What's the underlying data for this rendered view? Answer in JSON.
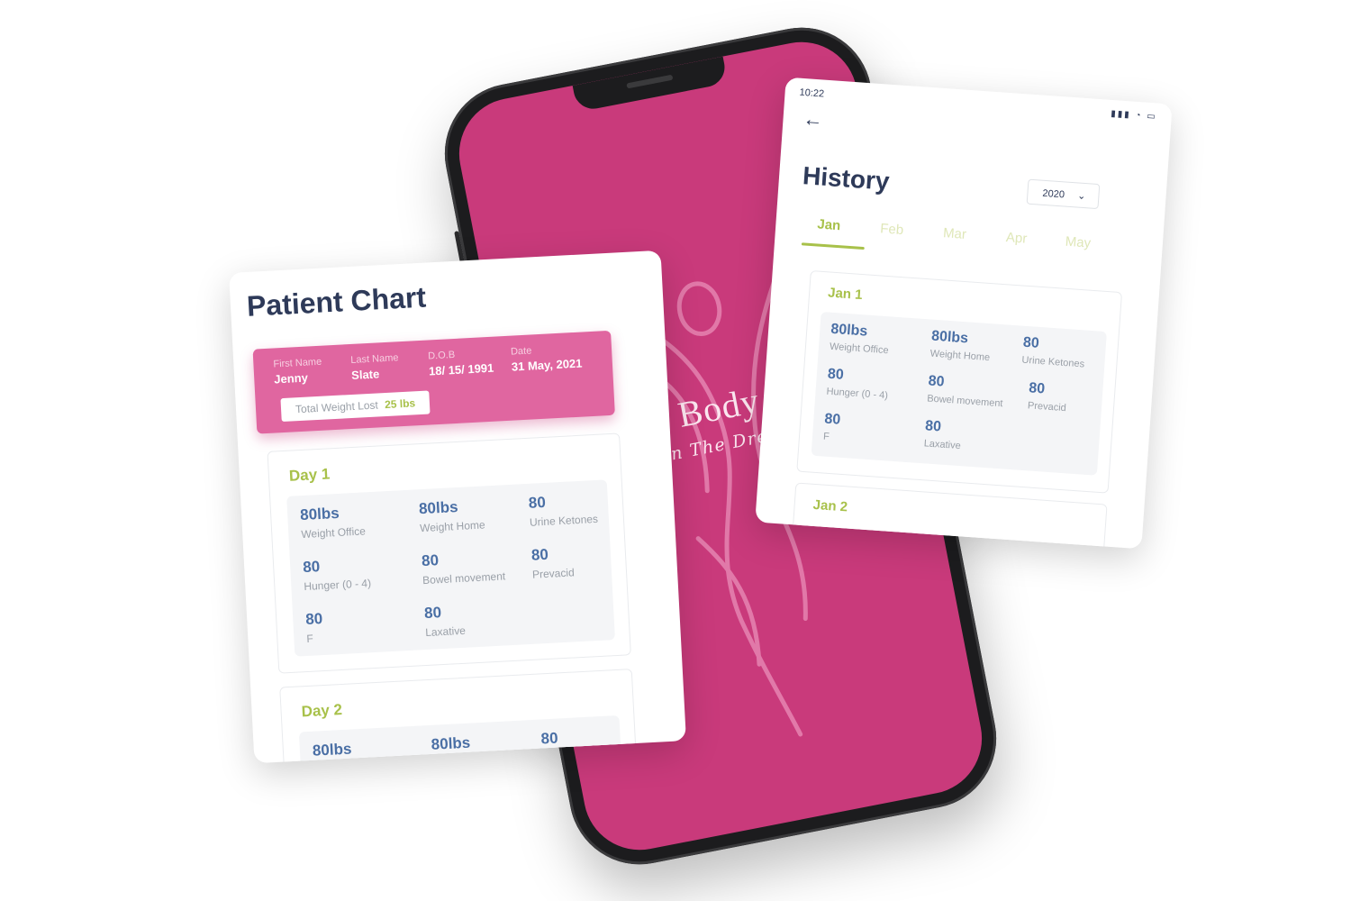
{
  "phone": {
    "brand_title": "m Body Syste",
    "brand_tagline": "aken The Dream Within"
  },
  "patient_chart": {
    "title": "Patient Chart",
    "patient": {
      "first_name_label": "First Name",
      "first_name": "Jenny",
      "last_name_label": "Last Name",
      "last_name": "Slate",
      "dob_label": "D.O.B",
      "dob": "18/ 15/ 1991",
      "date_label": "Date",
      "date": "31 May, 2021",
      "total_weight_label": "Total Weight Lost",
      "total_weight_value": "25 lbs"
    },
    "days": [
      {
        "title": "Day 1",
        "metrics": [
          {
            "value": "80lbs",
            "label": "Weight Office"
          },
          {
            "value": "80lbs",
            "label": "Weight Home"
          },
          {
            "value": "80",
            "label": "Urine Ketones"
          },
          {
            "value": "80",
            "label": "Hunger (0 - 4)"
          },
          {
            "value": "80",
            "label": "Bowel movement"
          },
          {
            "value": "80",
            "label": "Prevacid"
          },
          {
            "value": "80",
            "label": "F"
          },
          {
            "value": "80",
            "label": "Laxative"
          }
        ]
      },
      {
        "title": "Day 2",
        "metrics": [
          {
            "value": "80lbs",
            "label": ""
          },
          {
            "value": "80lbs",
            "label": ""
          },
          {
            "value": "80",
            "label": ""
          }
        ]
      }
    ]
  },
  "history": {
    "status_time": "10:22",
    "status_icons": "▮▮▮ ◔ ▭",
    "back_icon": "←",
    "title": "History",
    "year": "2020",
    "year_chevron": "⌄",
    "months": [
      "Jan",
      "Feb",
      "Mar",
      "Apr",
      "May"
    ],
    "active_month": "Jan",
    "entries": [
      {
        "title": "Jan 1",
        "metrics": [
          {
            "value": "80lbs",
            "label": "Weight Office"
          },
          {
            "value": "80lbs",
            "label": "Weight Home"
          },
          {
            "value": "80",
            "label": "Urine Ketones"
          },
          {
            "value": "80",
            "label": "Hunger (0 - 4)"
          },
          {
            "value": "80",
            "label": "Bowel movement"
          },
          {
            "value": "80",
            "label": "Prevacid"
          },
          {
            "value": "80",
            "label": "F"
          },
          {
            "value": "80",
            "label": "Laxative"
          }
        ]
      },
      {
        "title": "Jan 2",
        "metrics": []
      }
    ]
  },
  "colors": {
    "brand_pink": "#c93a7b",
    "bar_pink": "#e066a0",
    "accent_green": "#a8c14a",
    "navy": "#2e3a59",
    "value_blue": "#4a6fa5"
  }
}
